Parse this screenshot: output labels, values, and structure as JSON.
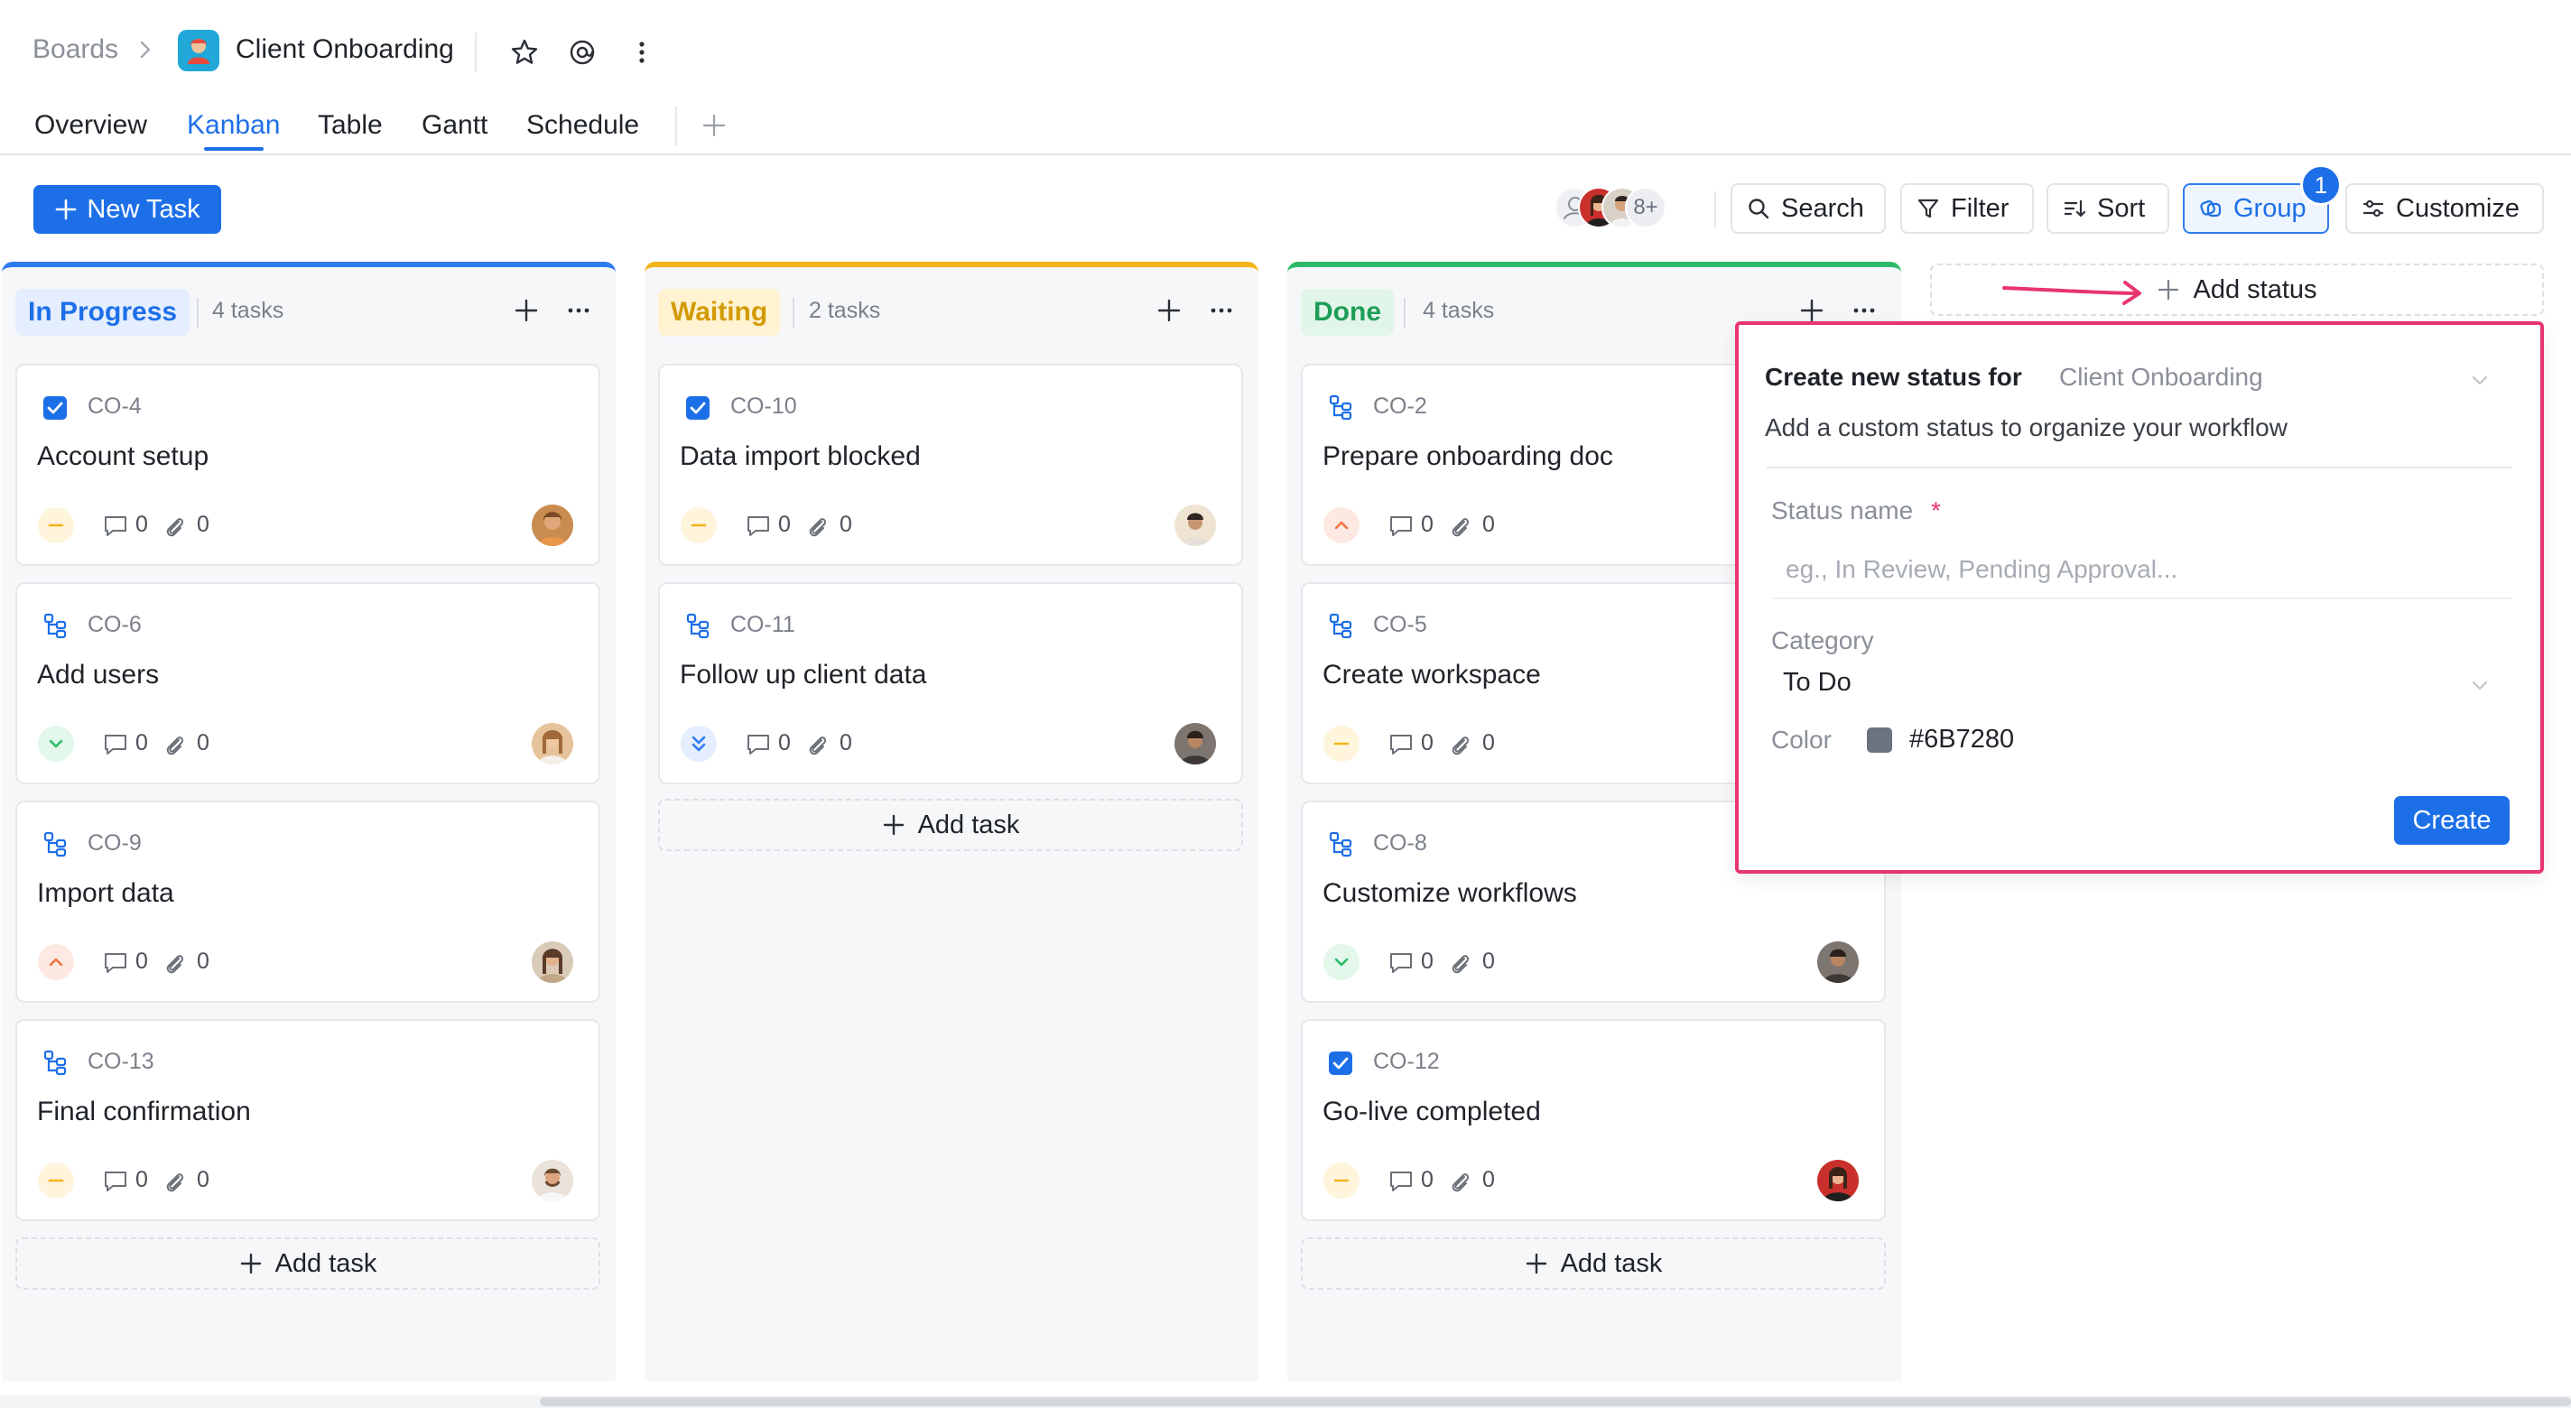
{
  "header": {
    "breadcrumb_root": "Boards",
    "board_title": "Client Onboarding",
    "tabs": [
      {
        "label": "Overview"
      },
      {
        "label": "Kanban"
      },
      {
        "label": "Table"
      },
      {
        "label": "Gantt"
      },
      {
        "label": "Schedule"
      }
    ],
    "active_tab": "Kanban"
  },
  "toolbar": {
    "new_task_label": "New Task",
    "members_more": "8+",
    "search_label": "Search",
    "filter_label": "Filter",
    "sort_label": "Sort",
    "group_label": "Group",
    "group_badge": "1",
    "customize_label": "Customize"
  },
  "colors": {
    "accent": "#1D6FE8",
    "in_progress": "#2F7BF0",
    "waiting": "#F2B51B",
    "done": "#2DBA6A",
    "highlight": "#E8356D"
  },
  "columns": [
    {
      "name": "In Progress",
      "count_label": "4 tasks",
      "cards": [
        {
          "id": "CO-4",
          "title": "Account setup",
          "type_icon": "checkbox-icon",
          "priority": "medium",
          "comments": "0",
          "attachments": "0"
        },
        {
          "id": "CO-6",
          "title": "Add users",
          "type_icon": "subtask-icon",
          "priority": "low",
          "comments": "0",
          "attachments": "0"
        },
        {
          "id": "CO-9",
          "title": "Import data",
          "type_icon": "subtask-icon",
          "priority": "high",
          "comments": "0",
          "attachments": "0"
        },
        {
          "id": "CO-13",
          "title": "Final confirmation",
          "type_icon": "subtask-icon",
          "priority": "medium",
          "comments": "0",
          "attachments": "0"
        }
      ],
      "add_task_label": "Add task"
    },
    {
      "name": "Waiting",
      "count_label": "2 tasks",
      "cards": [
        {
          "id": "CO-10",
          "title": "Data import blocked",
          "type_icon": "checkbox-icon",
          "priority": "medium",
          "comments": "0",
          "attachments": "0"
        },
        {
          "id": "CO-11",
          "title": "Follow up client data",
          "type_icon": "subtask-icon",
          "priority": "lowest",
          "comments": "0",
          "attachments": "0"
        }
      ],
      "add_task_label": "Add task"
    },
    {
      "name": "Done",
      "count_label": "4 tasks",
      "cards": [
        {
          "id": "CO-2",
          "title": "Prepare onboarding doc",
          "type_icon": "subtask-icon",
          "priority": "high",
          "comments": "0",
          "attachments": "0"
        },
        {
          "id": "CO-5",
          "title": "Create workspace",
          "type_icon": "subtask-icon",
          "priority": "medium",
          "comments": "0",
          "attachments": "0"
        },
        {
          "id": "CO-8",
          "title": "Customize workflows",
          "type_icon": "subtask-icon",
          "priority": "low",
          "comments": "0",
          "attachments": "0"
        },
        {
          "id": "CO-12",
          "title": "Go-live completed",
          "type_icon": "checkbox-icon",
          "priority": "medium",
          "comments": "0",
          "attachments": "0"
        }
      ],
      "add_task_label": "Add task"
    }
  ],
  "add_status_label": "Add status",
  "status_popover": {
    "heading": "Create new status for",
    "board": "Client Onboarding",
    "description": "Add a custom status to organize your workflow",
    "status_name_label": "Status name",
    "required_mark": "*",
    "status_name_placeholder": "eg., In Review, Pending Approval...",
    "category_label": "Category",
    "category_value": "To Do",
    "color_label": "Color",
    "color_value": "#6B7280",
    "create_label": "Create"
  }
}
